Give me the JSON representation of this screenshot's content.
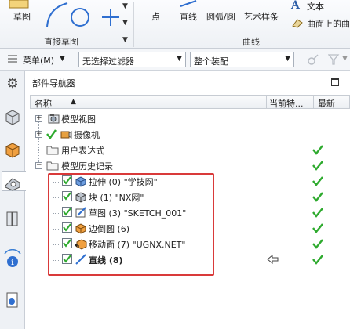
{
  "ribbon": {
    "sketch_label": "草图",
    "point_label": "点",
    "line_label": "直线",
    "arc_label": "圆弧/圆",
    "art_spline_label": "艺术样条",
    "text_label": "文本",
    "surface_curve_label": "曲面上的曲",
    "group_direct_sketch": "直接草图",
    "group_curve": "曲线"
  },
  "filterbar": {
    "menu_label": "菜单(M)",
    "filter_value": "无选择过滤器",
    "scope_value": "整个装配"
  },
  "navigator": {
    "title": "部件导航器",
    "columns": {
      "name": "名称",
      "current": "当前特...",
      "latest": "最新"
    },
    "items": [
      {
        "label": "模型视图"
      },
      {
        "label": "摄像机"
      },
      {
        "label": "用户表达式"
      },
      {
        "label": "模型历史记录"
      },
      {
        "label": "拉伸 (0) \"学技网\""
      },
      {
        "label": "块 (1) \"NX网\""
      },
      {
        "label": "草图 (3) \"SKETCH_001\""
      },
      {
        "label": "边倒圆 (6)"
      },
      {
        "label": "移动面 (7) \"UGNX.NET\""
      },
      {
        "label": "直线 (8)"
      }
    ]
  },
  "colors": {
    "check_green": "#2eaa2e",
    "highlight_red": "#d93a3a"
  }
}
